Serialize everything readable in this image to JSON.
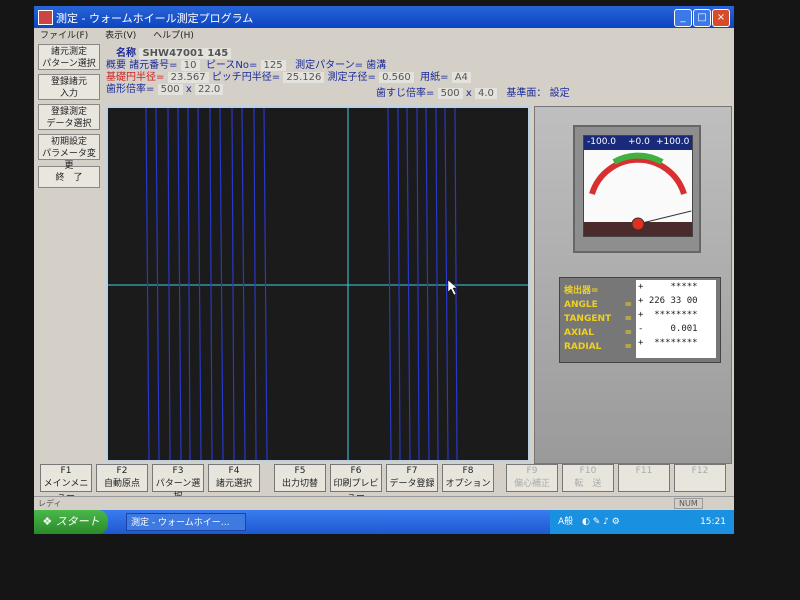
{
  "window": {
    "title": "測定 - ウォームホイール測定プログラム"
  },
  "menu": [
    "ファイル(F)",
    "表示(V)",
    "ヘルプ(H)"
  ],
  "left_buttons": [
    {
      "line1": "諸元測定",
      "line2": "パターン選択"
    },
    {
      "line1": "登録諸元",
      "line2": "入力"
    },
    {
      "line1": "登録測定",
      "line2": "データ選択"
    },
    {
      "line1": "初期設定",
      "line2": "パラメータ変更"
    },
    {
      "line1": "終　了",
      "line2": ""
    }
  ],
  "info": {
    "name_label": "名称",
    "name_value": "SHW47001 145",
    "overview_label": "概要",
    "spec_no_label": "諸元番号=",
    "spec_no_value": "10",
    "piece_no_label": "ピースNo=",
    "piece_no_value": "125",
    "pattern_label": "測定パターン=",
    "pattern_value": "歯溝",
    "base_radius_label": "基礎円半径=",
    "base_radius_value": "23.567",
    "pitch_radius_label": "ピッチ円半径=",
    "pitch_radius_value": "25.126",
    "measure_dia_label": "測定子径=",
    "measure_dia_value": "0.560",
    "paper_label": "用紙=",
    "paper_value": "A4",
    "tooth_mag_label": "歯形倍率=",
    "tooth_mag_x": "500",
    "tooth_mag_sep": "x",
    "tooth_mag_y": "22.0",
    "lead_mag_label": "歯すじ倍率=",
    "lead_mag_x": "500",
    "lead_mag_sep": "x",
    "lead_mag_y": "4.0",
    "ref_plane_label": "基準面：",
    "ref_plane_value": "設定"
  },
  "meter": {
    "scale_min": "-100.0",
    "scale_mid": "+0.0",
    "scale_max": "+100.0",
    "needle_fraction": 0.9
  },
  "readout": {
    "labels": [
      "検出器=",
      "ANGLE",
      "TANGENT",
      "AXIAL",
      "RADIAL"
    ],
    "eq": "=",
    "values": [
      "+     *****",
      "+ 226 33 00",
      "+  ********",
      "-     0.001",
      "+  ********"
    ]
  },
  "fkeys": [
    {
      "key": "F1",
      "label": "メインメニュー",
      "enabled": true
    },
    {
      "key": "F2",
      "label": "自動原点",
      "enabled": true
    },
    {
      "key": "F3",
      "label": "パターン選択",
      "enabled": true
    },
    {
      "key": "F4",
      "label": "諸元選択",
      "enabled": true
    },
    {
      "key": "F5",
      "label": "出力切替",
      "enabled": true
    },
    {
      "key": "F6",
      "label": "印刷プレビュー",
      "enabled": true
    },
    {
      "key": "F7",
      "label": "データ登録",
      "enabled": true
    },
    {
      "key": "F8",
      "label": "オプション",
      "enabled": true
    },
    {
      "key": "F9",
      "label": "偏心補正",
      "enabled": false
    },
    {
      "key": "F10",
      "label": "転　送",
      "enabled": false
    },
    {
      "key": "F11",
      "label": "",
      "enabled": false
    },
    {
      "key": "F12",
      "label": "",
      "enabled": false
    }
  ],
  "status": {
    "left": "レディ",
    "num": "NUM"
  },
  "taskbar": {
    "start": "スタート",
    "task": "測定 - ウォームホイー…",
    "ime": "A般",
    "clock": "15:21"
  },
  "colors": {
    "trace": "#2838c8",
    "axis": "#40d0e0",
    "label_highlight": "#f0d020"
  }
}
